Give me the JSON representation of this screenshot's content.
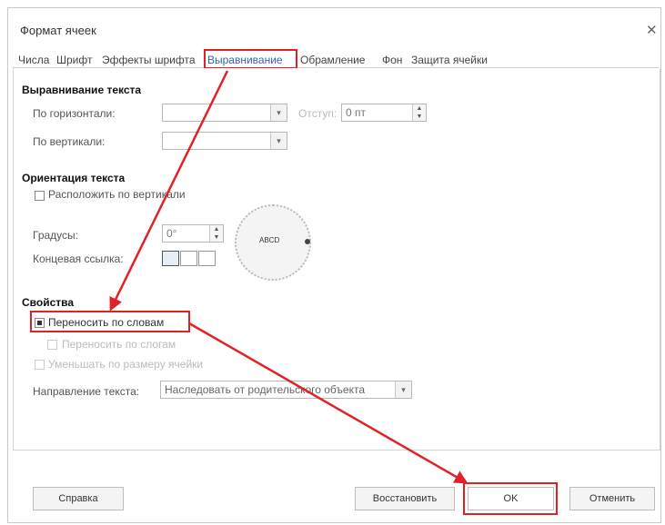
{
  "dialog": {
    "title": "Формат ячеек"
  },
  "tabs": [
    "Числа",
    "Шрифт",
    "Эффекты шрифта",
    "Выравнивание",
    "Обрамление",
    "Фон",
    "Защита ячейки"
  ],
  "alignment": {
    "section": "Выравнивание текста",
    "horizontal_label": "По горизонтали:",
    "horizontal_value": "",
    "indent_label": "Отступ:",
    "indent_value": "0 пт",
    "vertical_label": "По вертикали:",
    "vertical_value": ""
  },
  "orientation": {
    "section": "Ориентация текста",
    "vertical_stack_label": "Расположить по вертикали",
    "degrees_label": "Градусы:",
    "degrees_value": "0°",
    "ref_edge_label": "Концевая ссылка:",
    "dial_text": "ABCD"
  },
  "properties": {
    "section": "Свойства",
    "wrap_label": "Переносить по словам",
    "wrap_checked": true,
    "hyphenation_label": "Переносить по слогам",
    "shrink_label": "Уменьшать по размеру ячейки",
    "direction_label": "Направление текста:",
    "direction_value": "Наследовать от родительского объекта"
  },
  "buttons": {
    "help": "Справка",
    "reset": "Восстановить",
    "ok": "OK",
    "cancel": "Отменить"
  },
  "colors": {
    "annotation": "#e02228",
    "active_tab": "#3a5fa8"
  }
}
